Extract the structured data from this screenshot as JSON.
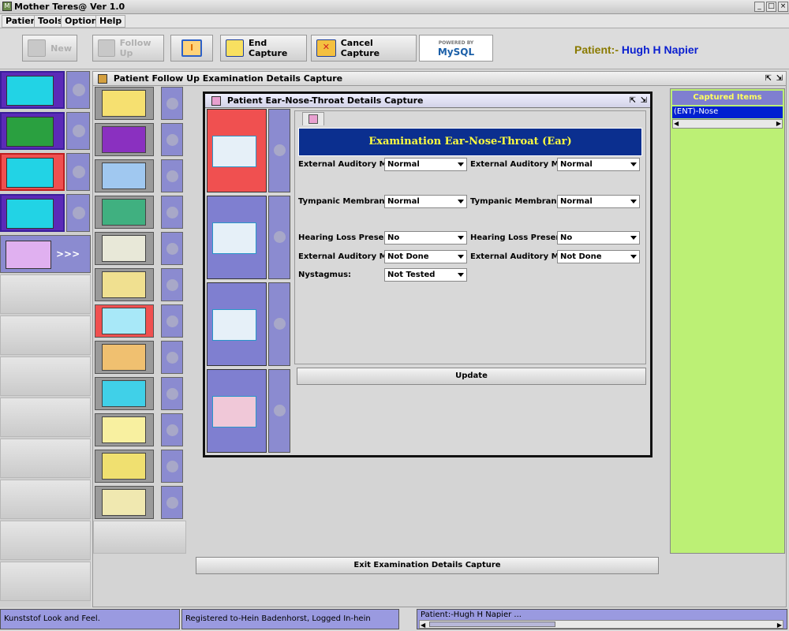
{
  "window": {
    "title": "Mother Teres@ Ver 1.0"
  },
  "menu": [
    "Patient",
    "Tools",
    "Options",
    "Help"
  ],
  "toolbar": {
    "new_label": "New",
    "followup_label": "Follow Up",
    "end_capture_label": "End Capture",
    "cancel_capture_label": "Cancel Capture",
    "mysql_label": "MySQL",
    "mysql_powered": "POWERED BY"
  },
  "patient": {
    "prefix": "Patient:-",
    "name": "Hugh H Napier"
  },
  "left_more_label": ">>>",
  "followup_frame": {
    "title": "Patient Follow Up Examination Details Capture"
  },
  "ent_frame": {
    "title": "Patient Ear-Nose-Throat Details Capture"
  },
  "exam": {
    "banner": "Examination Ear-Nose-Throat (Ear)",
    "rows": [
      {
        "left_label": "External Auditory Mea...",
        "left_value": "Normal",
        "right_label": "External Auditory Mea...",
        "right_value": "Normal"
      },
      {
        "left_label": "Tympanic Membrane:",
        "left_value": "Normal",
        "right_label": "Tympanic Membrane:",
        "right_value": "Normal"
      },
      {
        "left_label": "Hearing Loss Present:",
        "left_value": "No",
        "right_label": "Hearing Loss Present:",
        "right_value": "No"
      },
      {
        "left_label": "External Auditory Mea...",
        "left_value": "Not Done",
        "right_label": "External Auditory Mea...",
        "right_value": "Not Done"
      },
      {
        "left_label": "Nystagmus:",
        "left_value": "Not Tested"
      }
    ],
    "update_label": "Update"
  },
  "exit_label": "Exit Examination Details Capture",
  "captured": {
    "header": "Captured Items",
    "items": [
      "(ENT)-Nose"
    ]
  },
  "status": {
    "laf": "Kunststof Look and Feel.",
    "registered": "Registered to-Hein Badenhorst, Logged In-hein",
    "patient": "Patient:-Hugh H Napier ..."
  },
  "colors": {
    "accent": "#0b2f8f",
    "banner_text": "#ffff40",
    "captured_bg": "#bcf075",
    "patient_prefix": "#8a7a00",
    "patient_name": "#0a1fd0"
  },
  "icons": [
    "app-icon",
    "minimize-icon",
    "maximize-icon",
    "close-icon",
    "new-icon",
    "followup-icon",
    "info-icon",
    "end-capture-icon",
    "cancel-capture-icon",
    "mysql-logo"
  ]
}
